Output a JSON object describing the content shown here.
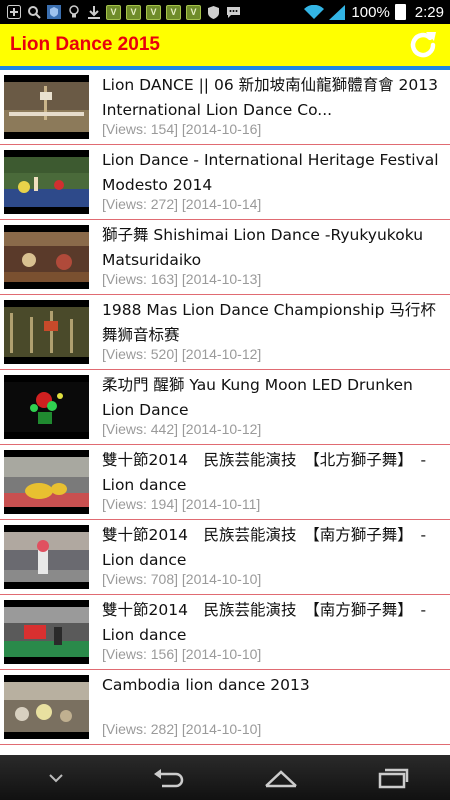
{
  "statusbar": {
    "battery": "100%",
    "time": "2:29",
    "icons": [
      "add-icon",
      "search-icon",
      "shield-app-icon",
      "bulb-icon",
      "download-icon",
      "app-v-icon",
      "app-v-icon",
      "app-v-icon",
      "app-v-icon",
      "app-v-icon",
      "shield-icon",
      "message-icon",
      "wifi-icon",
      "signal-icon",
      "battery-icon"
    ]
  },
  "header": {
    "title": "Lion Dance 2015",
    "title_color": "#e8000d",
    "background": "#ffff00",
    "accent": "#1e88e5"
  },
  "videos": [
    {
      "title": "Lion DANCE || 06 新加坡南仙龍獅體育會 2013 International Lion Dance Co...",
      "meta": "[Views: 154] [2014-10-16]",
      "thumb": "stage"
    },
    {
      "title": "Lion Dance - International Heritage Festival Modesto 2014",
      "meta": "[Views: 272] [2014-10-14]",
      "thumb": "outdoor"
    },
    {
      "title": "獅子舞 Shishimai Lion Dance -Ryukyukoku Matsuridaiko",
      "meta": "[Views: 163] [2014-10-13]",
      "thumb": "hall"
    },
    {
      "title": "1988 Mas Lion Dance Championship 马行杯舞狮音标赛",
      "meta": "[Views: 520] [2014-10-12]",
      "thumb": "poles"
    },
    {
      "title": "柔功門 醒獅 Yau Kung Moon LED Drunken Lion Dance",
      "meta": "[Views: 442] [2014-10-12]",
      "thumb": "led"
    },
    {
      "title": "雙十節2014　民族芸能演技　【北方獅子舞】　-　Lion dance",
      "meta": "[Views: 194] [2014-10-11]",
      "thumb": "street-yellow"
    },
    {
      "title": "雙十節2014　民族芸能演技　【南方獅子舞】　-　Lion dance",
      "meta": "[Views: 708] [2014-10-10]",
      "thumb": "street-white"
    },
    {
      "title": "雙十節2014　民族芸能演技　【南方獅子舞】　-　Lion dance",
      "meta": "[Views: 156] [2014-10-10]",
      "thumb": "street-red"
    },
    {
      "title": "Cambodia lion dance 2013",
      "meta": "[Views: 282] [2014-10-10]",
      "thumb": "crowd"
    }
  ],
  "navbar": {
    "buttons": [
      "collapse-icon",
      "back-icon",
      "home-icon",
      "recent-apps-icon"
    ]
  }
}
